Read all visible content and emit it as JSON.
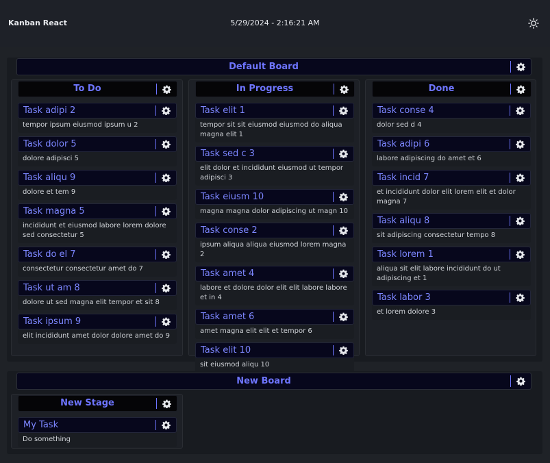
{
  "app": {
    "title": "Kanban React",
    "datetime": "5/29/2024 - 2:16:21 AM"
  },
  "icons": {
    "theme": "sun-icon",
    "settings": "gear-icon"
  },
  "colors": {
    "accent": "#6e75ff",
    "background": "#1f2227",
    "header_bg": "#07071c"
  },
  "boards": [
    {
      "title": "Default Board",
      "columns": [
        {
          "title": "To Do",
          "cards": [
            {
              "title": "Task adipi 2",
              "desc": "tempor ipsum eiusmod ipsum u 2"
            },
            {
              "title": "Task dolor 5",
              "desc": "dolore adipisci 5"
            },
            {
              "title": "Task aliqu 9",
              "desc": "dolore et tem 9"
            },
            {
              "title": "Task magna 5",
              "desc": "incididunt et eiusmod labore lorem dolore sed consectetur 5"
            },
            {
              "title": "Task do el 7",
              "desc": "consectetur consectetur amet do 7"
            },
            {
              "title": "Task ut am 8",
              "desc": "dolore ut sed magna elit tempor et sit 8"
            },
            {
              "title": "Task ipsum 9",
              "desc": "elit incididunt amet dolor dolore amet do 9"
            }
          ]
        },
        {
          "title": "In Progress",
          "cards": [
            {
              "title": "Task elit 1",
              "desc": "tempor sit sit eiusmod eiusmod do aliqua magna elit 1"
            },
            {
              "title": "Task sed c 3",
              "desc": "elit dolor et incididunt eiusmod ut tempor adipisci 3"
            },
            {
              "title": "Task eiusm 10",
              "desc": "magna magna dolor adipiscing ut magn 10"
            },
            {
              "title": "Task conse 2",
              "desc": "ipsum aliqua aliqua eiusmod lorem magna 2"
            },
            {
              "title": "Task amet 4",
              "desc": "labore et dolore dolor elit elit labore labore et in 4"
            },
            {
              "title": "Task amet 6",
              "desc": "amet magna elit elit et tempor 6"
            },
            {
              "title": "Task elit 10",
              "desc": "sit eiusmod aliqu 10"
            }
          ]
        },
        {
          "title": "Done",
          "cards": [
            {
              "title": "Task conse 4",
              "desc": "dolor sed d 4"
            },
            {
              "title": "Task adipi 6",
              "desc": "labore adipiscing do amet et 6"
            },
            {
              "title": "Task incid 7",
              "desc": "et incididunt dolor elit lorem elit et dolor magna 7"
            },
            {
              "title": "Task aliqu 8",
              "desc": "sit adipiscing consectetur tempo 8"
            },
            {
              "title": "Task lorem 1",
              "desc": "aliqua sit elit labore incididunt do ut adipiscing et 1"
            },
            {
              "title": "Task labor 3",
              "desc": "et lorem dolore 3"
            }
          ]
        }
      ]
    },
    {
      "title": "New Board",
      "columns": [
        {
          "title": "New Stage",
          "cards": [
            {
              "title": "My Task",
              "desc": "Do something"
            }
          ]
        }
      ]
    }
  ]
}
